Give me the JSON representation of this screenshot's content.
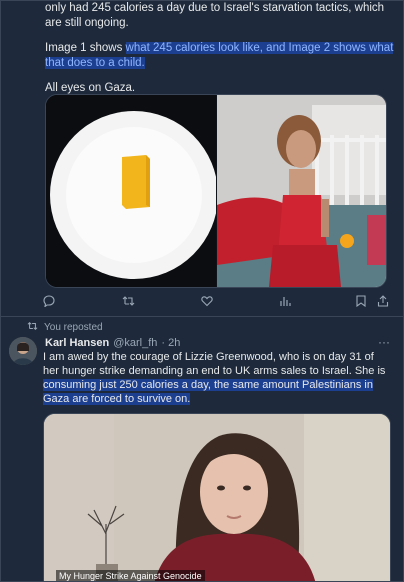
{
  "tweet1": {
    "line1": "only had 245 calories a day due to Israel's starvation tactics, which are still ongoing.",
    "line2_prefix": "Image 1 shows ",
    "line2_highlight": "what 245 calories look like, and Image 2 shows what that does to a child.",
    "line3": "All eyes on Gaza."
  },
  "actions": {
    "icons": [
      "reply-icon",
      "retweet-icon",
      "like-icon",
      "views-icon",
      "bookmark-icon",
      "share-icon"
    ]
  },
  "repost": {
    "label": "You reposted"
  },
  "tweet2": {
    "name": "Karl Hansen",
    "handle": "@karl_fh",
    "time": "· 2h",
    "more": "···",
    "text_plain": "I am awed by the courage of Lizzie Greenwood, who is on day 31 of her hunger strike demanding an end to UK arms sales to Israel. She is ",
    "text_highlight": "consuming just 250 calories a day, the same amount Palestinians in Gaza are forced to survive on.",
    "video_caption": "My Hunger Strike Against Genocide"
  },
  "colors": {
    "background": "#1e2a3b",
    "highlight": "#1d3f8f",
    "muted": "#9aa7b5"
  }
}
